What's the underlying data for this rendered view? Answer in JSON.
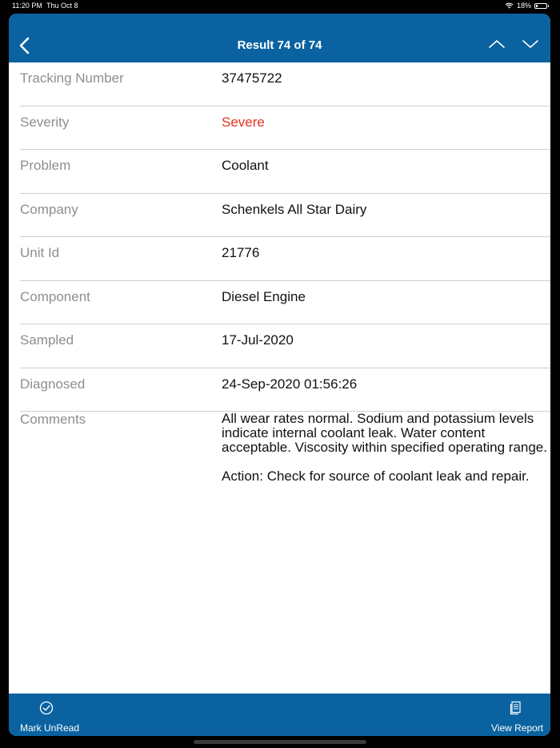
{
  "status_bar": {
    "time": "11:20 PM",
    "date": "Thu Oct 8",
    "battery": "18%",
    "battery_level": 0.18
  },
  "nav": {
    "title": "Result 74 of 74",
    "back_icon": "chevron-left-icon",
    "up_icon": "chevron-up-icon",
    "down_icon": "chevron-down-icon"
  },
  "details": {
    "tracking_number": {
      "label": "Tracking Number",
      "value": "37475722"
    },
    "severity": {
      "label": "Severity",
      "value": "Severe",
      "color": "#e2321e"
    },
    "problem": {
      "label": "Problem",
      "value": "Coolant"
    },
    "company": {
      "label": "Company",
      "value": "Schenkels All Star Dairy"
    },
    "unit_id": {
      "label": "Unit Id",
      "value": "21776"
    },
    "component": {
      "label": "Component",
      "value": "Diesel Engine"
    },
    "sampled": {
      "label": "Sampled",
      "value": "17-Jul-2020"
    },
    "diagnosed": {
      "label": "Diagnosed",
      "value": "24-Sep-2020 01:56:26"
    },
    "comments": {
      "label": "Comments",
      "value": "All wear rates normal. Sodium and potassium levels indicate internal coolant leak. Water content acceptable. Viscosity within specified operating range.\n\nAction: Check for source of coolant leak and repair."
    }
  },
  "tab_bar": {
    "mark_unread": {
      "label": "Mark UnRead",
      "icon": "checkmark-circle-icon"
    },
    "view_report": {
      "label": "View Report",
      "icon": "document-icon"
    }
  },
  "colors": {
    "accent": "#0a63a0",
    "label_gray": "#8e8e93",
    "severe_red": "#e2321e"
  }
}
